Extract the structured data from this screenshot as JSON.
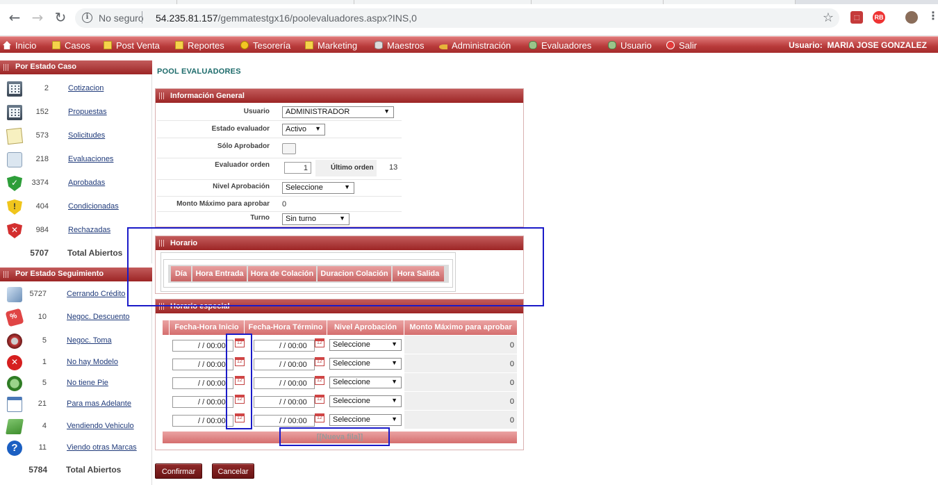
{
  "browser": {
    "security": "No seguro",
    "url_host": "54.235.81.157",
    "url_path": "/gemmatestgx16/poolevaluadores.aspx?INS,0",
    "ext_rb": "RB"
  },
  "menu": {
    "items": [
      {
        "label": "Inicio",
        "icon": "home-icon"
      },
      {
        "label": "Casos",
        "icon": "folder-icon"
      },
      {
        "label": "Post Venta",
        "icon": "folder-icon"
      },
      {
        "label": "Reportes",
        "icon": "folder-icon"
      },
      {
        "label": "Tesorería",
        "icon": "coin-icon"
      },
      {
        "label": "Marketing",
        "icon": "folder-icon"
      },
      {
        "label": "Maestros",
        "icon": "database-icon"
      },
      {
        "label": "Administración",
        "icon": "key-icon"
      },
      {
        "label": "Evaluadores",
        "icon": "users-icon"
      },
      {
        "label": "Usuario",
        "icon": "users-icon"
      },
      {
        "label": "Salir",
        "icon": "exit-icon"
      }
    ],
    "user_label": "Usuario:",
    "user_name": "MARIA JOSE GONZALEZ"
  },
  "sidebar": {
    "estado_caso": {
      "title": "Por Estado Caso",
      "items": [
        {
          "count": "2",
          "label": "Cotizacion",
          "icon": "calculator-icon"
        },
        {
          "count": "152",
          "label": "Propuestas",
          "icon": "calculator-icon"
        },
        {
          "count": "573",
          "label": "Solicitudes",
          "icon": "note-icon"
        },
        {
          "count": "218",
          "label": "Evaluaciones",
          "icon": "magnifier-icon"
        },
        {
          "count": "3374",
          "label": "Aprobadas",
          "icon": "shield-check-icon"
        },
        {
          "count": "404",
          "label": "Condicionadas",
          "icon": "shield-warning-icon"
        },
        {
          "count": "984",
          "label": "Rechazadas",
          "icon": "shield-x-icon"
        }
      ],
      "total_count": "5707",
      "total_label": "Total Abiertos"
    },
    "estado_seguimiento": {
      "title": "Por Estado Seguimiento",
      "items": [
        {
          "count": "5727",
          "label": "Cerrando Crédito",
          "icon": "pen-icon"
        },
        {
          "count": "10",
          "label": "Negoc. Descuento",
          "icon": "discount-tag-icon"
        },
        {
          "count": "5",
          "label": "Negoc. Toma",
          "icon": "wheel-icon"
        },
        {
          "count": "1",
          "label": "No hay Modelo",
          "icon": "x-circle-icon"
        },
        {
          "count": "5",
          "label": "No tiene Pie",
          "icon": "coins-icon"
        },
        {
          "count": "21",
          "label": "Para mas Adelante",
          "icon": "calendar-icon"
        },
        {
          "count": "4",
          "label": "Vendiendo Vehiculo",
          "icon": "money-icon"
        },
        {
          "count": "11",
          "label": "Viendo otras Marcas",
          "icon": "help-icon"
        }
      ],
      "total_count": "5784",
      "total_label": "Total Abiertos"
    }
  },
  "page": {
    "title": "POOL EVALUADORES"
  },
  "general": {
    "title": "Información General",
    "usuario_label": "Usuario",
    "usuario_value": "ADMINISTRADOR",
    "estado_label": "Estado evaluador",
    "estado_value": "Activo",
    "solo_label": "Sólo Aprobador",
    "orden_label": "Evaluador orden",
    "orden_value": "1",
    "ultimo_label": "Último orden",
    "ultimo_value": "13",
    "nivel_label": "Nivel Aprobación",
    "nivel_value": "Seleccione",
    "monto_label": "Monto Máximo para aprobar",
    "monto_value": "0",
    "turno_label": "Turno",
    "turno_value": "Sin turno"
  },
  "horario": {
    "title": "Horario",
    "columns": [
      "Día",
      "Hora Entrada",
      "Hora de Colación",
      "Duracion Colación",
      "Hora Salida"
    ]
  },
  "especial": {
    "title": "Horario especial",
    "columns": [
      "Fecha-Hora Inicio",
      "Fecha-Hora Término",
      "Nivel Aprobación",
      "Monto Máximo para aprobar"
    ],
    "rows": [
      {
        "inicio": "/ /  00:00",
        "termino": "/ /  00:00",
        "nivel": "Seleccione",
        "monto": "0"
      },
      {
        "inicio": "/ /  00:00",
        "termino": "/ /  00:00",
        "nivel": "Seleccione",
        "monto": "0"
      },
      {
        "inicio": "/ /  00:00",
        "termino": "/ /  00:00",
        "nivel": "Seleccione",
        "monto": "0"
      },
      {
        "inicio": "/ /  00:00",
        "termino": "/ /  00:00",
        "nivel": "Seleccione",
        "monto": "0"
      },
      {
        "inicio": "/ /  00:00",
        "termino": "/ /  00:00",
        "nivel": "Seleccione",
        "monto": "0"
      }
    ],
    "new_row": "[[Nueva fila]]"
  },
  "actions": {
    "confirm": "Confirmar",
    "cancel": "Cancelar"
  },
  "colors": {
    "menu_red": "#b83a3a",
    "header_red": "#9c2525",
    "title_teal": "#1d6b6b",
    "highlight_blue": "#1a1ac8"
  }
}
